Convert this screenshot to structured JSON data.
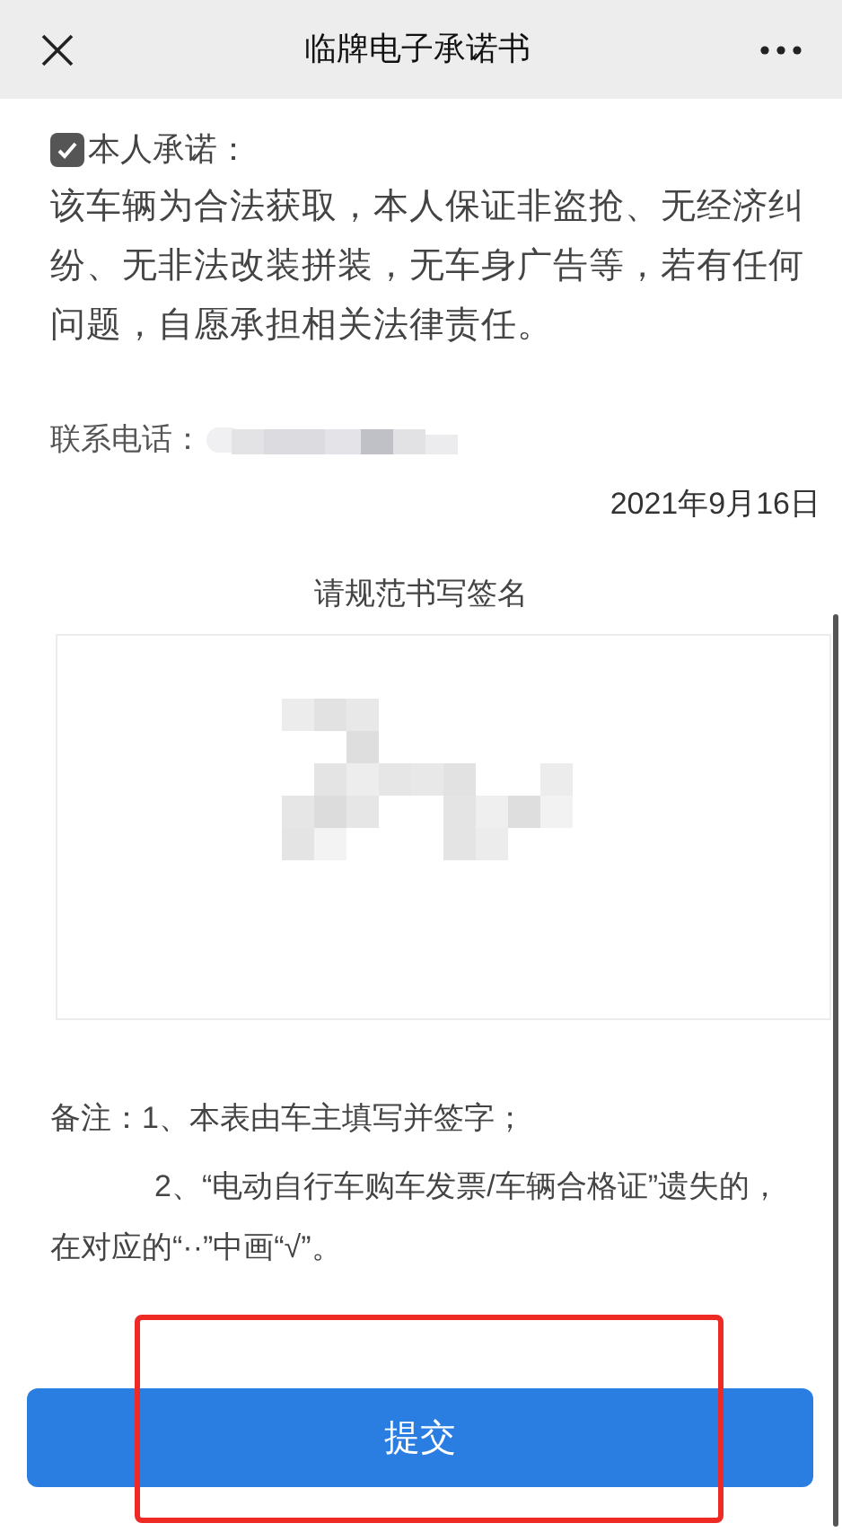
{
  "header": {
    "title": "临牌电子承诺书"
  },
  "pledge": {
    "label": "本人承诺：",
    "checked": true,
    "text": "该车辆为合法获取，本人保证非盗抢、无经济纠纷、无非法改装拼装，无车身广告等，若有任何问题，自愿承担相关法律责任。"
  },
  "contact": {
    "label": "联系电话："
  },
  "date": "2021年9月16日",
  "signature": {
    "label": "请规范书写签名"
  },
  "notes": [
    {
      "text": "备注：1、本表由车主填写并签字；",
      "kind": "first"
    },
    {
      "text": "2、“电动自行车购车发票/车辆合格证”遗失的，在对应的“··”中画“√”。",
      "kind": "indented"
    }
  ],
  "submit": {
    "label": "提交"
  }
}
